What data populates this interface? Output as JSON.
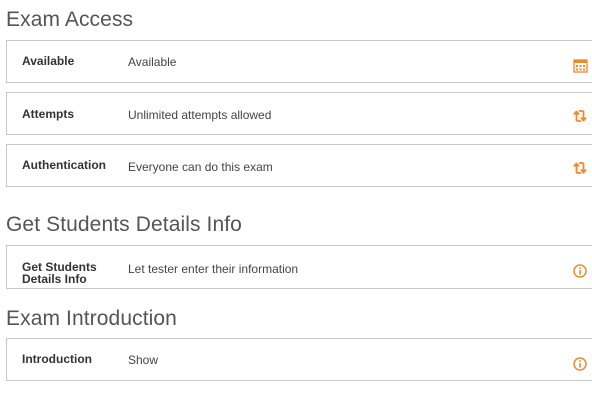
{
  "sections": {
    "exam_access": {
      "title": "Exam Access",
      "available": {
        "label": "Available",
        "value": "Available",
        "icon": "calendar-icon"
      },
      "attempts": {
        "label": "Attempts",
        "value": "Unlimited attempts allowed",
        "icon": "swap-arrows-icon"
      },
      "authentication": {
        "label": "Authentication",
        "value": "Everyone can do this exam",
        "icon": "swap-arrows-icon"
      }
    },
    "student_details": {
      "title": "Get Students Details Info",
      "details": {
        "label_line1": "Get Students",
        "label_line2": "Details Info",
        "value": "Let tester enter their information",
        "icon": "info-icon"
      }
    },
    "exam_intro": {
      "title": "Exam Introduction",
      "introduction": {
        "label": "Introduction",
        "value": "Show",
        "icon": "info-icon"
      }
    }
  },
  "colors": {
    "accent": "#f0892b",
    "border": "#c8c8c8",
    "heading": "#555555"
  }
}
